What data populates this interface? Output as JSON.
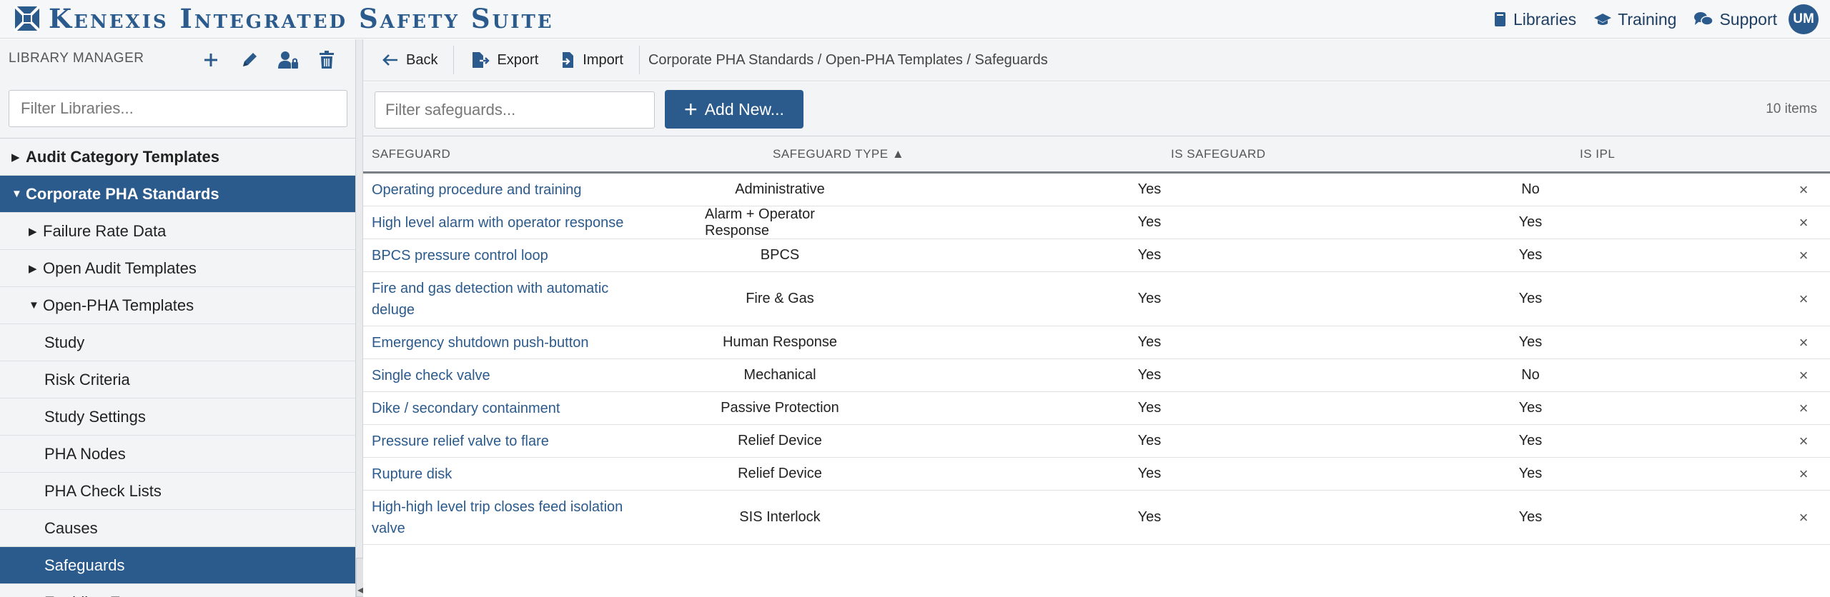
{
  "app": {
    "title": "Kenexis Integrated Safety Suite"
  },
  "topnav": {
    "libraries": "Libraries",
    "training": "Training",
    "support": "Support",
    "user_initials": "UM"
  },
  "sidebar": {
    "title": "LIBRARY MANAGER",
    "filter_placeholder": "Filter Libraries...",
    "tree": [
      {
        "label": "Audit Category Templates",
        "level": 0,
        "caret": "▶",
        "active": false
      },
      {
        "label": "Corporate PHA Standards",
        "level": 0,
        "caret": "▼",
        "active": true
      },
      {
        "label": "Failure Rate Data",
        "level": 1,
        "caret": "▶",
        "active": false
      },
      {
        "label": "Open Audit Templates",
        "level": 1,
        "caret": "▶",
        "active": false
      },
      {
        "label": "Open-PHA Templates",
        "level": 1,
        "caret": "▼",
        "active": false
      },
      {
        "label": "Study",
        "level": 2,
        "caret": "",
        "active": false
      },
      {
        "label": "Risk Criteria",
        "level": 2,
        "caret": "",
        "active": false
      },
      {
        "label": "Study Settings",
        "level": 2,
        "caret": "",
        "active": false
      },
      {
        "label": "PHA Nodes",
        "level": 2,
        "caret": "",
        "active": false
      },
      {
        "label": "PHA Check Lists",
        "level": 2,
        "caret": "",
        "active": false
      },
      {
        "label": "Causes",
        "level": 2,
        "caret": "",
        "active": false
      },
      {
        "label": "Safeguards",
        "level": 2,
        "caret": "",
        "active": true
      },
      {
        "label": "Enabling Events",
        "level": 2,
        "caret": "",
        "active": false
      }
    ]
  },
  "toolbar": {
    "back": "Back",
    "export": "Export",
    "import": "Import",
    "breadcrumb": "Corporate PHA Standards / Open-PHA Templates / Safeguards"
  },
  "actions": {
    "filter_placeholder": "Filter safeguards...",
    "add_new": "Add New...",
    "item_count": "10 items"
  },
  "table": {
    "columns": {
      "safeguard": "SAFEGUARD",
      "safeguard_type": "SAFEGUARD TYPE ▲",
      "is_safeguard": "IS SAFEGUARD",
      "is_ipl": "IS IPL"
    },
    "rows": [
      {
        "safeguard": "Operating procedure and training",
        "type": "Administrative",
        "is_safeguard": "Yes",
        "is_ipl": "No"
      },
      {
        "safeguard": "High level alarm with operator response",
        "type": "Alarm + Operator Response",
        "is_safeguard": "Yes",
        "is_ipl": "Yes"
      },
      {
        "safeguard": "BPCS pressure control loop",
        "type": "BPCS",
        "is_safeguard": "Yes",
        "is_ipl": "Yes"
      },
      {
        "safeguard": "Fire and gas detection with automatic deluge",
        "type": "Fire & Gas",
        "is_safeguard": "Yes",
        "is_ipl": "Yes"
      },
      {
        "safeguard": "Emergency shutdown push-button",
        "type": "Human Response",
        "is_safeguard": "Yes",
        "is_ipl": "Yes"
      },
      {
        "safeguard": "Single check valve",
        "type": "Mechanical",
        "is_safeguard": "Yes",
        "is_ipl": "No"
      },
      {
        "safeguard": "Dike / secondary containment",
        "type": "Passive Protection",
        "is_safeguard": "Yes",
        "is_ipl": "Yes"
      },
      {
        "safeguard": "Pressure relief valve to flare",
        "type": "Relief Device",
        "is_safeguard": "Yes",
        "is_ipl": "Yes"
      },
      {
        "safeguard": "Rupture disk",
        "type": "Relief Device",
        "is_safeguard": "Yes",
        "is_ipl": "Yes"
      },
      {
        "safeguard": "High-high level trip closes feed isolation valve",
        "type": "SIS Interlock",
        "is_safeguard": "Yes",
        "is_ipl": "Yes"
      }
    ],
    "delete_glyph": "×"
  },
  "colors": {
    "brand": "#2b5a8c",
    "link": "#2b5a8c",
    "panel": "#f3f4f5"
  }
}
